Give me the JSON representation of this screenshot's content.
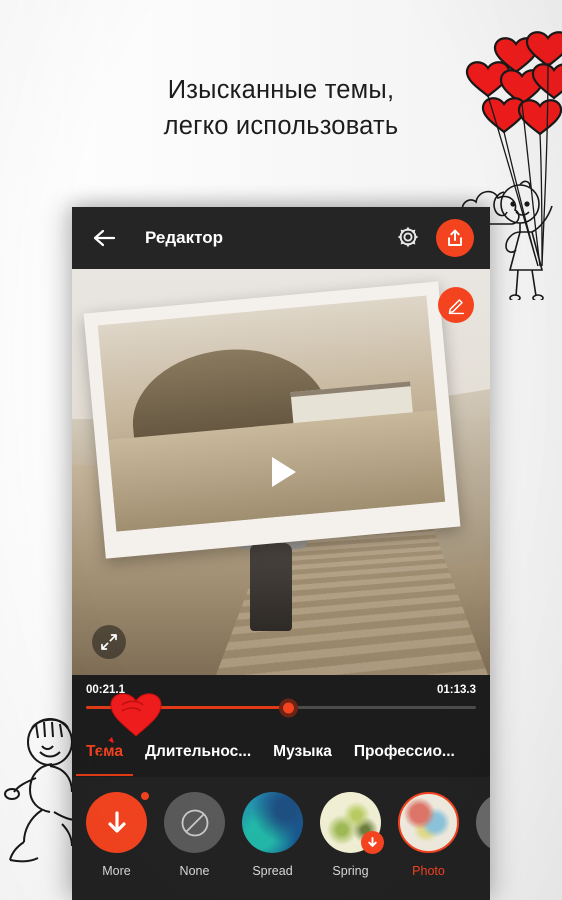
{
  "promo": {
    "headline": "Изысканные темы,\nлегко использовать",
    "accent_color": "#f4431f",
    "background_color": "#ffffff",
    "decorations": [
      {
        "name": "heart-balloons-illustration",
        "position": "top-right"
      },
      {
        "name": "cloud-illustration",
        "position": "top-right"
      },
      {
        "name": "girl-with-balloons-illustration",
        "position": "right"
      },
      {
        "name": "boy-holding-string-illustration",
        "position": "bottom-left"
      },
      {
        "name": "heart-balloon-illustration",
        "position": "tabs-left"
      }
    ]
  },
  "app": {
    "appbar": {
      "back_icon": "arrow-left-icon",
      "title": "Редактор",
      "settings_icon": "gear-icon",
      "share_icon": "share-upload-icon"
    },
    "preview": {
      "play_icon": "play-icon",
      "edit_icon": "pencil-icon",
      "expand_icon": "fullscreen-expand-icon",
      "frame_style": "tilted-white-photo-frame"
    },
    "timeline": {
      "current_time": "00:21.1",
      "total_time": "01:13.3",
      "progress_percent": 52,
      "track_color": "#4c4c4c",
      "filled_color": "#e23a16",
      "knob_color": "#f4431f"
    },
    "tabs": [
      {
        "label": "Тема",
        "active": true
      },
      {
        "label": "Длительнос...",
        "active": false
      },
      {
        "label": "Музыка",
        "active": false
      },
      {
        "label": "Профессио...",
        "active": false
      }
    ],
    "themes": [
      {
        "label": "More",
        "kind": "more",
        "icon": "download-arrow-icon",
        "selected": false,
        "badge": "dot"
      },
      {
        "label": "None",
        "kind": "none",
        "icon": "no-theme-icon",
        "selected": false,
        "badge": ""
      },
      {
        "label": "Spread",
        "kind": "spread",
        "icon": "",
        "selected": false,
        "badge": ""
      },
      {
        "label": "Spring",
        "kind": "spring",
        "icon": "",
        "selected": false,
        "badge": "download"
      },
      {
        "label": "Photo",
        "kind": "photo",
        "icon": "",
        "selected": true,
        "badge": ""
      },
      {
        "label": "",
        "kind": "next",
        "icon": "",
        "selected": false,
        "badge": ""
      }
    ]
  }
}
